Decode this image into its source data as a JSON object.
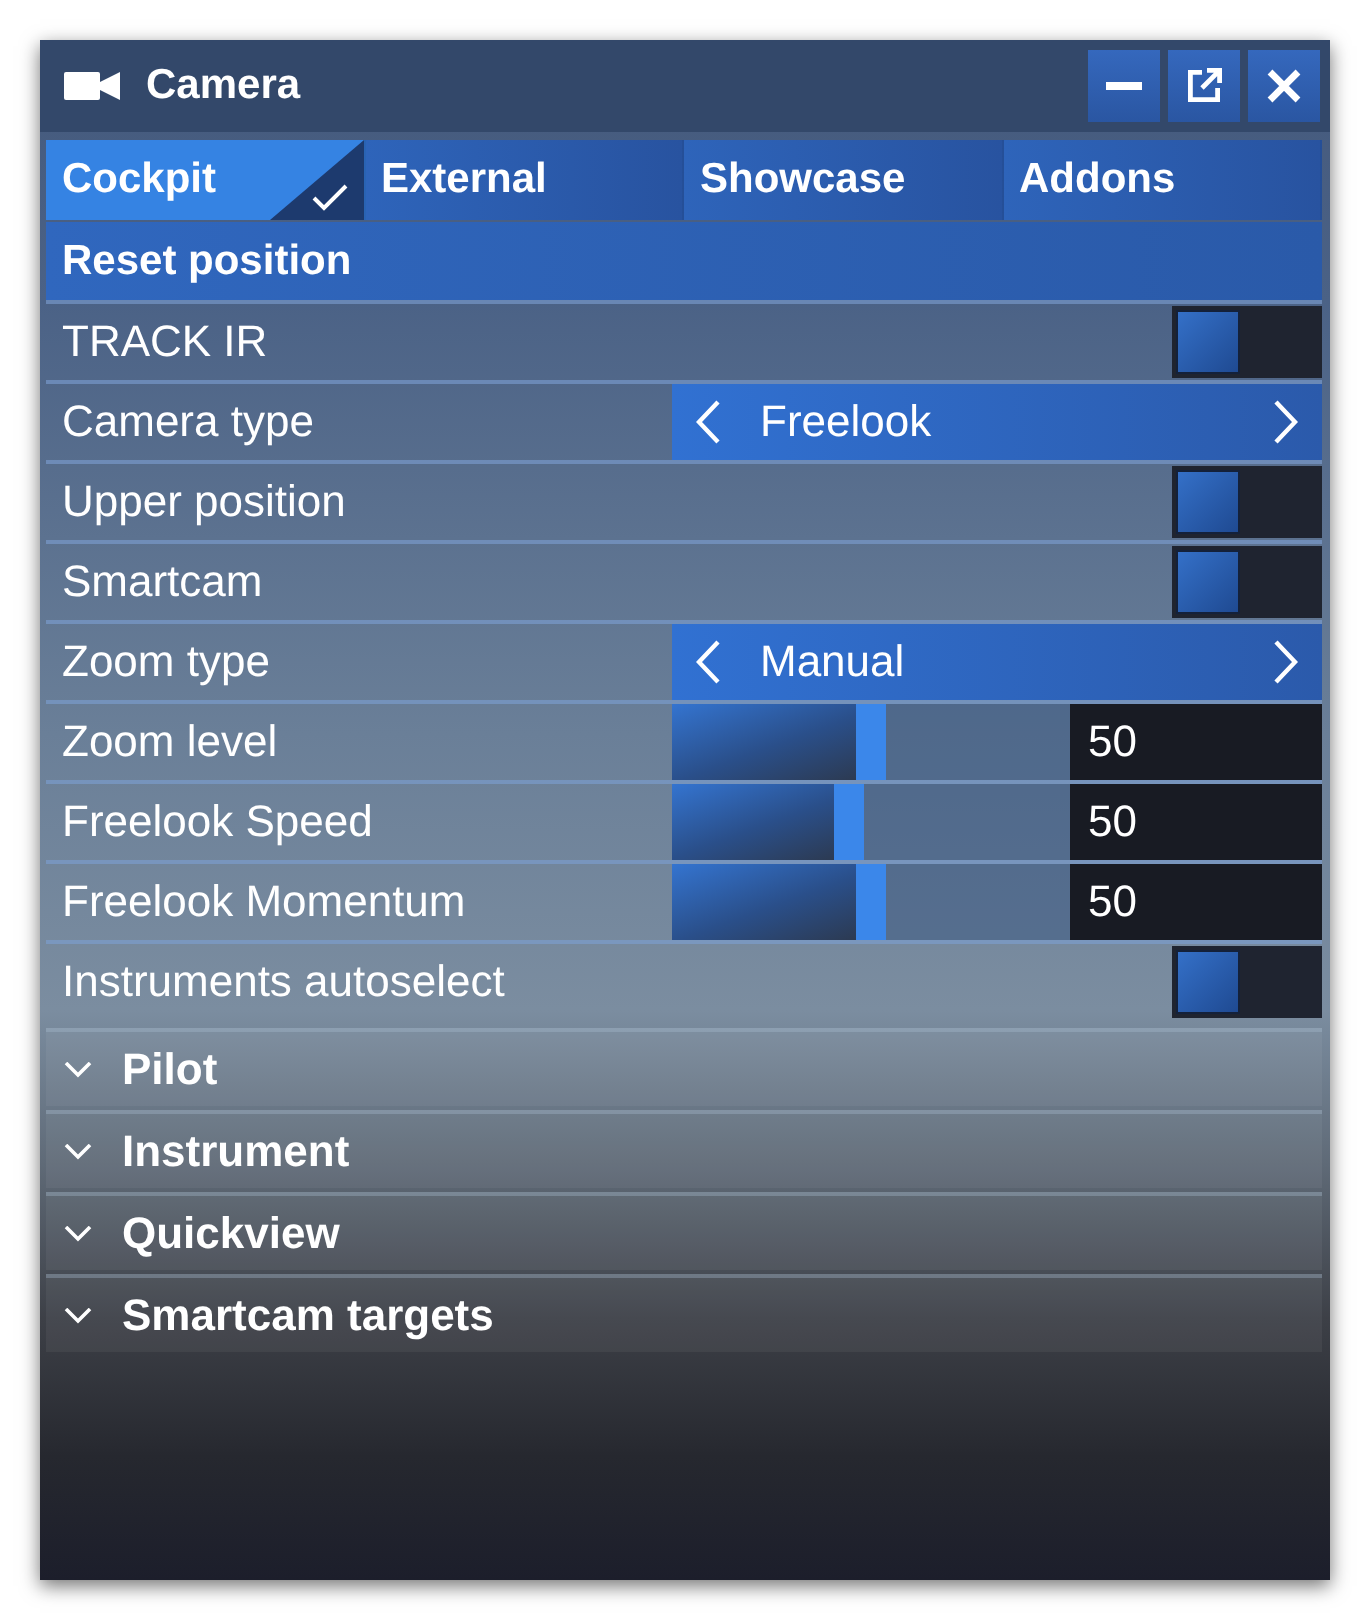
{
  "window": {
    "title": "Camera"
  },
  "tabs": [
    {
      "label": "Cockpit",
      "selected": true
    },
    {
      "label": "External",
      "selected": false
    },
    {
      "label": "Showcase",
      "selected": false
    },
    {
      "label": "Addons",
      "selected": false
    }
  ],
  "reset_button": {
    "label": "Reset position"
  },
  "settings": [
    {
      "kind": "toggle",
      "label": "TRACK IR",
      "on": false
    },
    {
      "kind": "selector",
      "label": "Camera type",
      "value": "Freelook"
    },
    {
      "kind": "toggle",
      "label": "Upper position",
      "on": false
    },
    {
      "kind": "toggle",
      "label": "Smartcam",
      "on": false
    },
    {
      "kind": "selector",
      "label": "Zoom type",
      "value": "Manual"
    },
    {
      "kind": "slider",
      "label": "Zoom level",
      "level": 0.5,
      "value": "50"
    },
    {
      "kind": "slider",
      "label": "Freelook Speed",
      "level": 0.44,
      "value": "50"
    },
    {
      "kind": "slider",
      "label": "Freelook Momentum",
      "level": 0.5,
      "value": "50"
    },
    {
      "kind": "toggle",
      "label": "Instruments autoselect",
      "on": false
    }
  ],
  "sections": [
    {
      "label": "Pilot",
      "expanded": false
    },
    {
      "label": "Instrument",
      "expanded": false
    },
    {
      "label": "Quickview",
      "expanded": false
    },
    {
      "label": "Smartcam targets",
      "expanded": false
    }
  ]
}
